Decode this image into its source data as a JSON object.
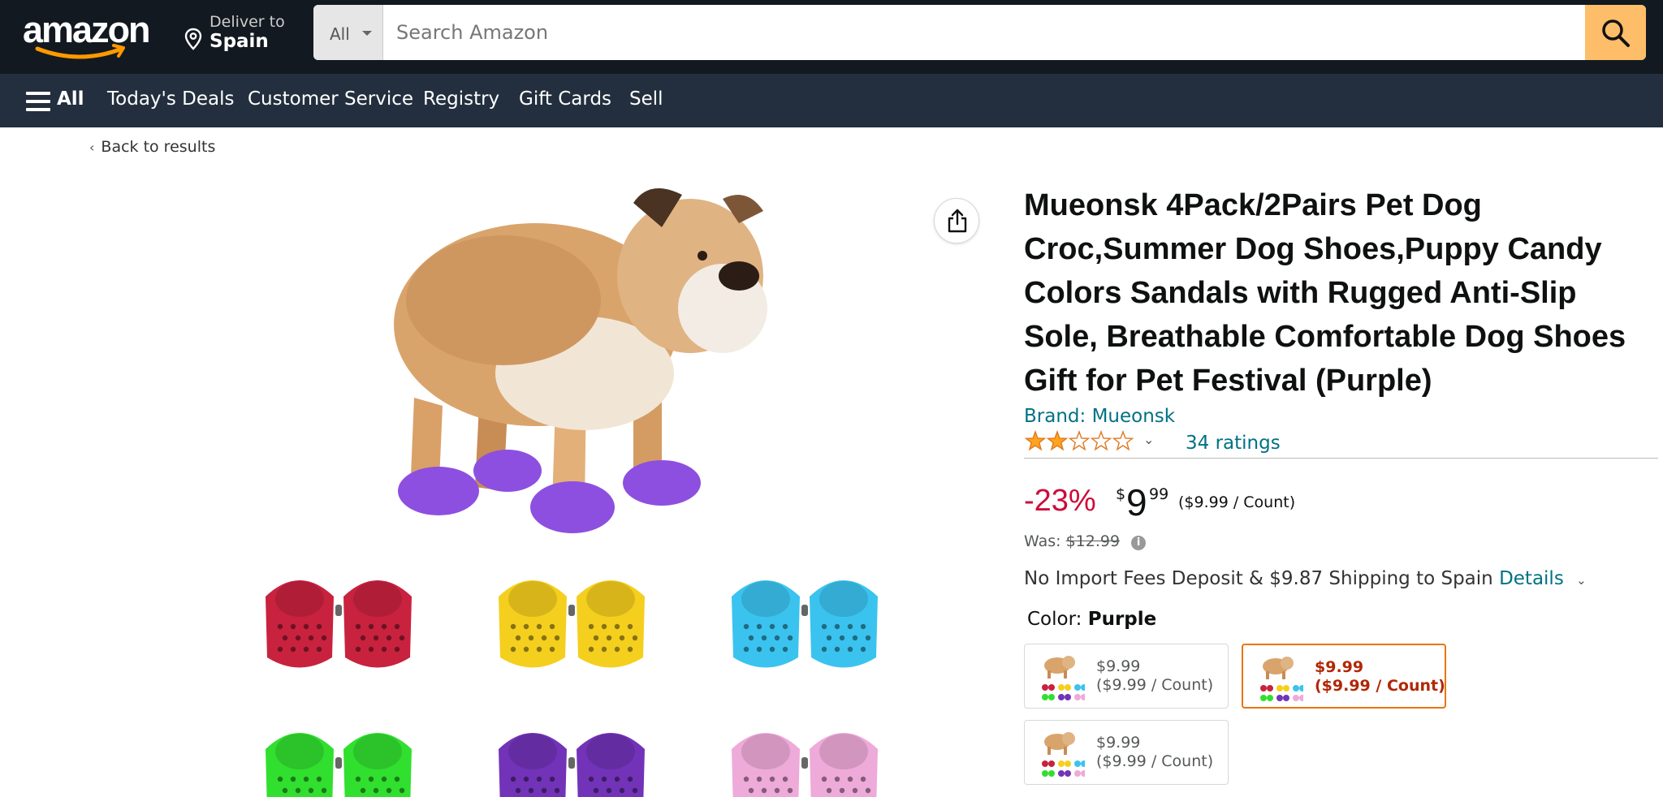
{
  "header": {
    "logo_text": "amazon",
    "deliver_line1": "Deliver to",
    "deliver_line2": "Spain",
    "search_dept": "All",
    "search_placeholder": "Search Amazon"
  },
  "nav": {
    "all_label": "All",
    "links": [
      "Today's Deals",
      "Customer Service",
      "Registry",
      "Gift Cards",
      "Sell"
    ]
  },
  "breadcrumb": {
    "back_label": "Back to results"
  },
  "gallery": {
    "thumb_colors": [
      "#c8223f",
      "#f5cf1e",
      "#3bc3ef",
      "#31df2f",
      "#7233b8",
      "#eeaad9"
    ],
    "main_shoe_color": "#8d4fe0"
  },
  "product": {
    "title": "Mueonsk 4Pack/2Pairs Pet Dog Croc,Summer Dog Shoes,Puppy Candy Colors Sandals with Rugged Anti-Slip Sole, Breathable Comfortable Dog Shoes Gift for Pet Festival (Purple)",
    "brand": "Brand: Mueonsk",
    "rating_stars": 2,
    "rating_max": 5,
    "ratings_count": "34 ratings",
    "discount": "-23%",
    "currency_symbol": "$",
    "price_whole": "9",
    "price_fraction": "99",
    "price_per_unit": "($9.99 / Count)",
    "was_label": "Was:",
    "was_price": "$12.99",
    "shipping_text": "No Import Fees Deposit & $9.87 Shipping to Spain",
    "shipping_details": "Details",
    "color_label": "Color:",
    "color_value": "Purple",
    "swatches": [
      {
        "price": "$9.99",
        "unit": "($9.99 / Count)",
        "selected": false
      },
      {
        "price": "$9.99",
        "unit": "($9.99 / Count)",
        "selected": true
      },
      {
        "price": "$9.99",
        "unit": "($9.99 / Count)",
        "selected": false
      }
    ]
  },
  "colors": {
    "header_bg": "#131921",
    "subnav_bg": "#232f3e",
    "search_button": "#febd69",
    "link": "#007185",
    "discount": "#cc0c39",
    "star": "#ffa41c",
    "selected_border": "#e77600"
  }
}
